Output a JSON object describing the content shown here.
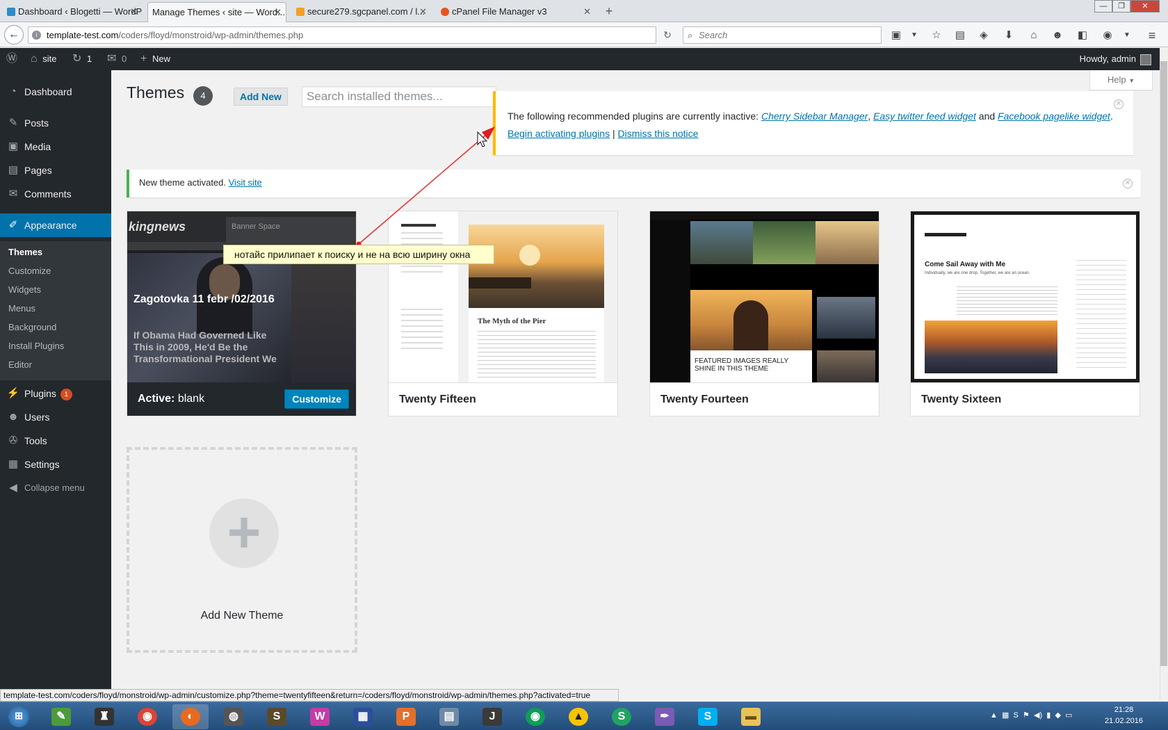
{
  "browser": {
    "tabs": [
      {
        "title": "Dashboard ‹ Blogetti — WordP...",
        "active": false
      },
      {
        "title": "Manage Themes ‹ site — Word...",
        "active": true
      },
      {
        "title": "secure279.sgcpanel.com / l...",
        "active": false
      },
      {
        "title": "cPanel File Manager v3",
        "active": false
      }
    ],
    "url_host": "template-test.com",
    "url_path": "/coders/floyd/monstroid/wp-admin/themes.php",
    "search_placeholder": "Search",
    "status_url": "template-test.com/coders/floyd/monstroid/wp-admin/customize.php?theme=twentyfifteen&return=/coders/floyd/monstroid/wp-admin/themes.php?activated=true"
  },
  "adminbar": {
    "site": "site",
    "updates": "1",
    "comments": "0",
    "new": "New",
    "howdy": "Howdy, admin"
  },
  "sidebar": {
    "items": [
      {
        "label": "Dashboard",
        "icon": "dashboard-icon"
      },
      {
        "label": "Posts",
        "icon": "pin-icon"
      },
      {
        "label": "Media",
        "icon": "media-icon"
      },
      {
        "label": "Pages",
        "icon": "pages-icon"
      },
      {
        "label": "Comments",
        "icon": "comments-icon"
      },
      {
        "label": "Appearance",
        "icon": "brush-icon"
      },
      {
        "label": "Plugins",
        "icon": "plug-icon",
        "badge": "1"
      },
      {
        "label": "Users",
        "icon": "users-icon"
      },
      {
        "label": "Tools",
        "icon": "wrench-icon"
      },
      {
        "label": "Settings",
        "icon": "settings-icon"
      },
      {
        "label": "Collapse menu",
        "icon": "collapse-icon"
      }
    ],
    "submenu": [
      "Themes",
      "Customize",
      "Widgets",
      "Menus",
      "Background",
      "Install Plugins",
      "Editor"
    ]
  },
  "page": {
    "title": "Themes",
    "count": "4",
    "add_new": "Add New",
    "search_placeholder": "Search installed themes...",
    "help": "Help"
  },
  "notice": {
    "text": "The following recommended plugins are currently inactive: ",
    "plugin1": "Cherry Sidebar Manager",
    "comma": ", ",
    "plugin2": "Easy twitter feed widget",
    "and": " and ",
    "plugin3": "Facebook pagelike widget",
    "period": ".",
    "begin": "Begin activating plugins",
    "sep": " | ",
    "dismiss": "Dismiss this notice"
  },
  "activated": {
    "text": "New theme activated. ",
    "link": "Visit site"
  },
  "themes": {
    "active_prefix": "Active:",
    "active_name": "blank",
    "customize": "Customize",
    "active_shot_title": "Zagotovka 11 febr /02/2016",
    "active_shot_headline": "If Obama Had Governed Like This in 2009, He'd Be the Transformational President We",
    "active_shot_logo": "kingnews",
    "active_shot_banner": "Banner Space",
    "fifteen": "Twenty Fifteen",
    "fifteen_post": "The Myth of the Pier",
    "fourteen": "Twenty Fourteen",
    "fourteen_caption": "FEATURED IMAGES REALLY SHINE IN THIS THEME",
    "sixteen": "Twenty Sixteen",
    "sixteen_post": "Come Sail Away with Me",
    "sixteen_sub": "Individually, we are one drop. Together, we are an ocean."
  },
  "add_theme": {
    "label": "Add New Theme"
  },
  "annotation": "нотайс прилипает к поиску и не на всю ширину окна",
  "taskbar": {
    "time": "21:28",
    "date": "21.02.2016"
  },
  "colors": {
    "wp_blue": "#0073aa",
    "admin_dark": "#23282d",
    "notice_yellow": "#ffb900",
    "success_green": "#46b450"
  }
}
